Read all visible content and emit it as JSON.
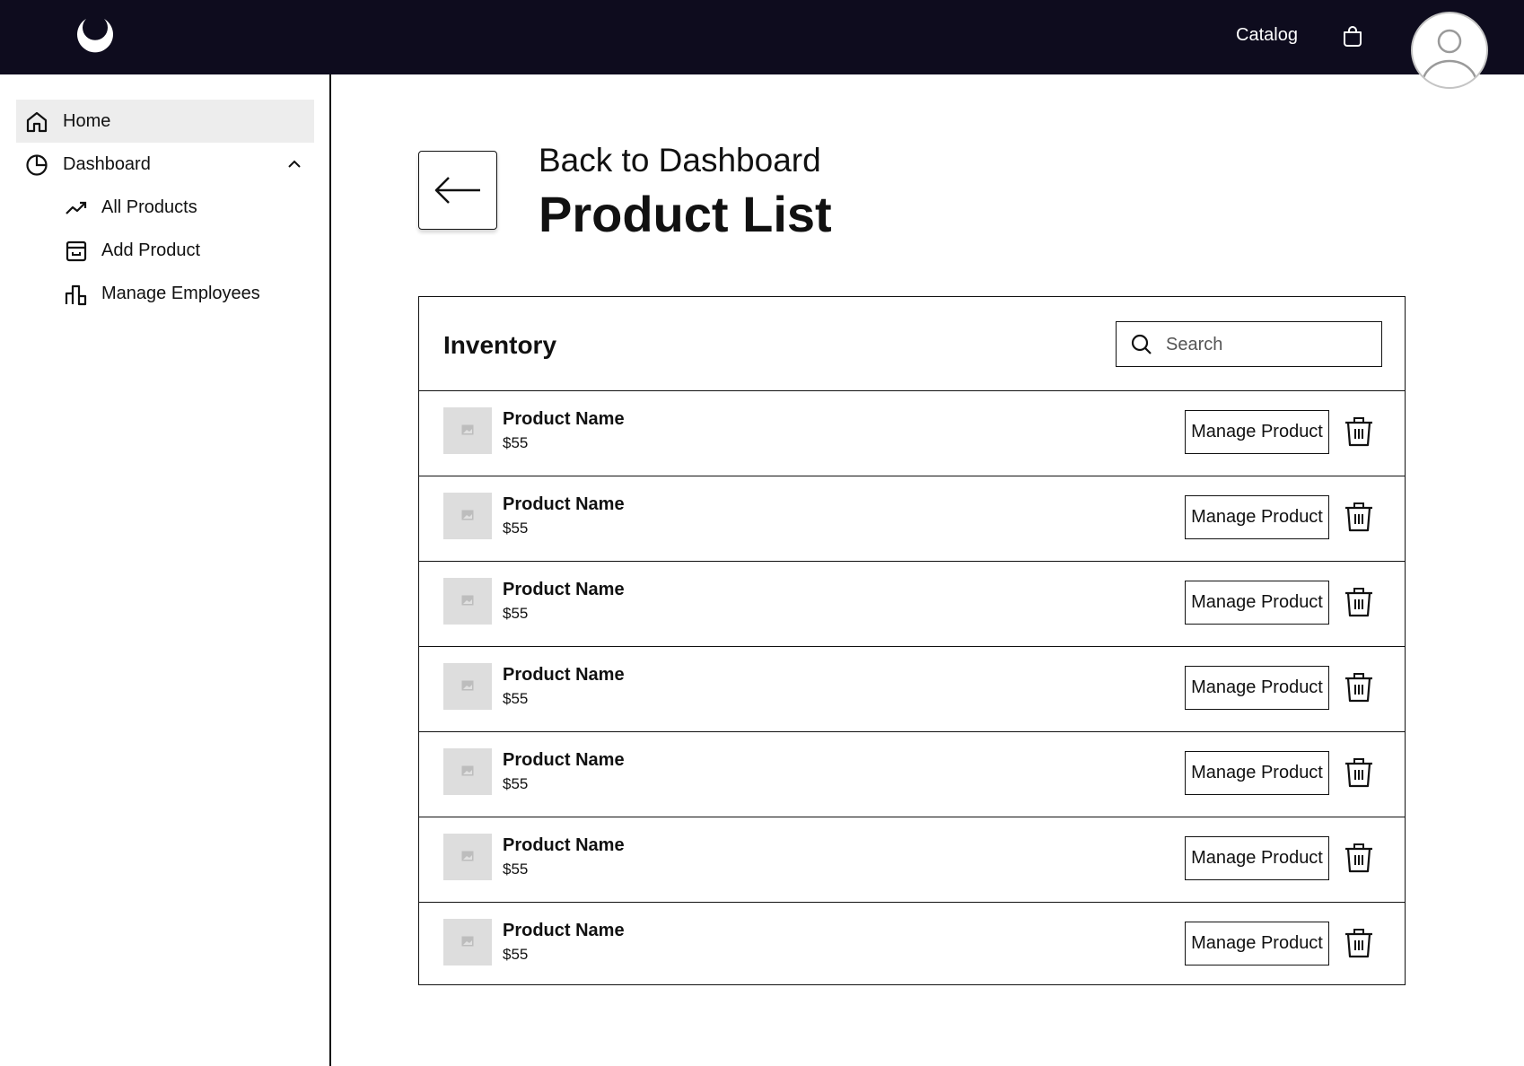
{
  "topbar": {
    "logo_icon": "crescent-logo-icon",
    "catalog_label": "Catalog",
    "cart_icon": "shopping-bag-icon",
    "avatar_icon": "user-avatar-icon",
    "background": "#0e0c1e"
  },
  "sidebar": {
    "items": [
      {
        "label": "Home",
        "icon": "home-icon",
        "active": true
      },
      {
        "label": "Dashboard",
        "icon": "pie-chart-icon",
        "expanded": true
      }
    ],
    "subitems": [
      {
        "label": "All Products",
        "icon": "trending-up-icon"
      },
      {
        "label": "Add Product",
        "icon": "archive-box-icon"
      },
      {
        "label": "Manage Employees",
        "icon": "bar-chart-icon"
      }
    ]
  },
  "header": {
    "back_label": "Back to Dashboard",
    "title": "Product List"
  },
  "inventory": {
    "title": "Inventory",
    "search_placeholder": "Search",
    "manage_label": "Manage Product",
    "rows": [
      {
        "name": "Product Name",
        "price": "$55"
      },
      {
        "name": "Product Name",
        "price": "$55"
      },
      {
        "name": "Product Name",
        "price": "$55"
      },
      {
        "name": "Product Name",
        "price": "$55"
      },
      {
        "name": "Product Name",
        "price": "$55"
      },
      {
        "name": "Product Name",
        "price": "$55"
      },
      {
        "name": "Product Name",
        "price": "$55"
      }
    ]
  }
}
